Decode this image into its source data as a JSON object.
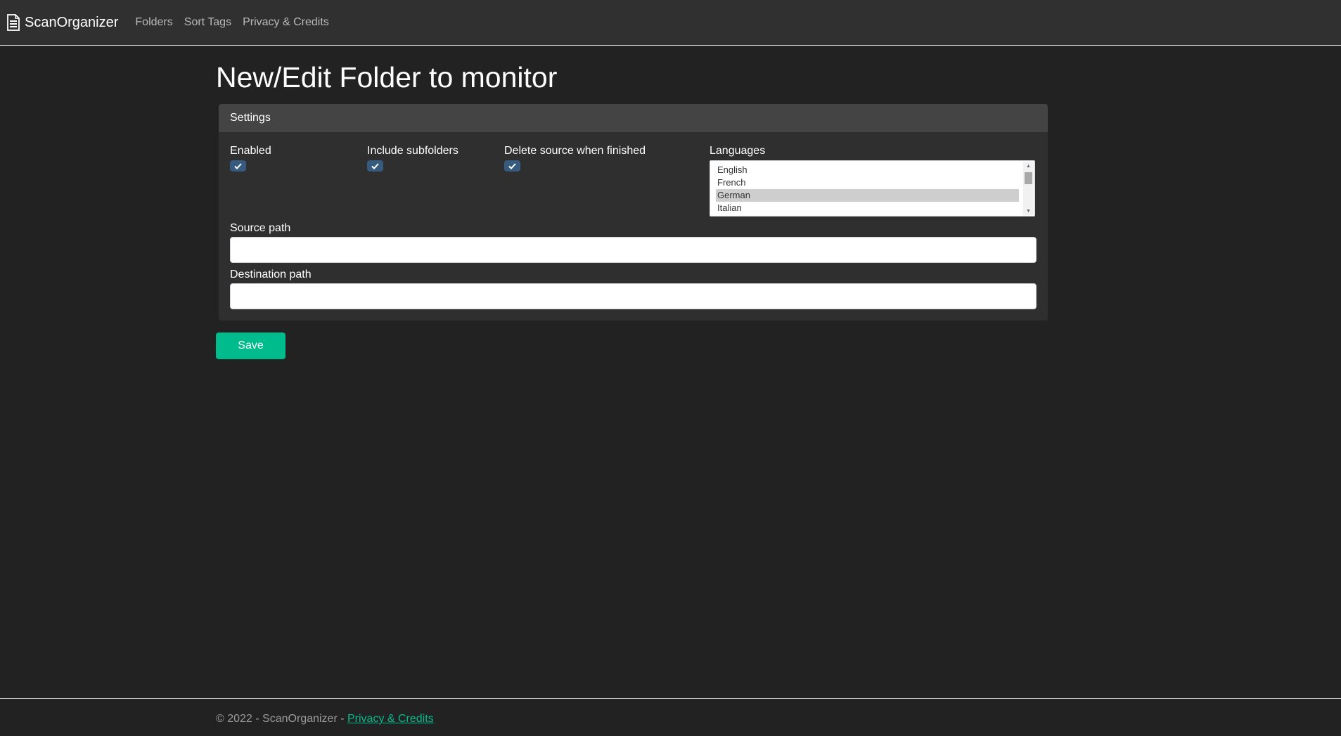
{
  "nav": {
    "brand": "ScanOrganizer",
    "links": [
      "Folders",
      "Sort Tags",
      "Privacy & Credits"
    ]
  },
  "page": {
    "title": "New/Edit Folder to monitor"
  },
  "settings": {
    "header": "Settings",
    "enabled_label": "Enabled",
    "enabled_checked": true,
    "subfolders_label": "Include subfolders",
    "subfolders_checked": true,
    "delete_label": "Delete source when finished",
    "delete_checked": true,
    "languages_label": "Languages",
    "languages": [
      "English",
      "French",
      "German",
      "Italian"
    ],
    "languages_selected": "German",
    "source_label": "Source path",
    "source_value": "",
    "dest_label": "Destination path",
    "dest_value": ""
  },
  "actions": {
    "save": "Save"
  },
  "footer": {
    "copyright": "© 2022 - ScanOrganizer - ",
    "link": "Privacy & Credits"
  },
  "colors": {
    "background": "#222222",
    "navbar": "#303030",
    "card": "#2f2f2f",
    "card_header": "#444444",
    "checkbox": "#375a7f",
    "accent": "#00bc8c"
  }
}
